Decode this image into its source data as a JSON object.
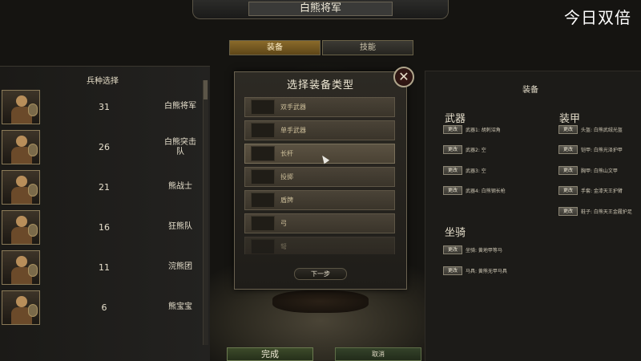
{
  "window": {
    "title": "白熊将军",
    "watermark": "今日双倍"
  },
  "tabs": [
    {
      "label": "装备",
      "active": true
    },
    {
      "label": "技能",
      "active": false
    }
  ],
  "left_panel": {
    "header": "兵种选择",
    "units": [
      {
        "count": "31",
        "name": "白熊将军"
      },
      {
        "count": "26",
        "name": "白熊突击队"
      },
      {
        "count": "21",
        "name": "熊战士"
      },
      {
        "count": "16",
        "name": "狂熊队"
      },
      {
        "count": "11",
        "name": "浣熊团"
      },
      {
        "count": "6",
        "name": "熊宝宝"
      }
    ]
  },
  "dialog": {
    "title": "选择装备类型",
    "close_icon": "close-icon",
    "options": [
      {
        "label": "双手武器"
      },
      {
        "label": "单手武器"
      },
      {
        "label": "长杆"
      },
      {
        "label": "投掷"
      },
      {
        "label": "盾牌"
      },
      {
        "label": "弓"
      },
      {
        "label": "弩"
      }
    ],
    "next_label": "下一步"
  },
  "right_panel": {
    "title": "装备",
    "weapons_title": "武器",
    "armor_title": "装甲",
    "mount_title": "坐骑",
    "change_label": "更改",
    "weapons": [
      "武器1: 胡刺沼角",
      "武器2: 空",
      "武器3: 空",
      "武器4: 白熊钢长枪"
    ],
    "armor": [
      "头盔: 白熊武绒光盔",
      "铠甲: 白熊光泽护甲",
      "胸甲: 白熊山文甲",
      "手套: 金漆天王护臂",
      "鞋子: 白熊天王金履护足"
    ],
    "mounts": [
      "坐骑: 黄地甲等马",
      "马具: 黄熊无甲马具"
    ]
  },
  "bottom": {
    "done_label": "完成",
    "cancel_label": "取消"
  },
  "colors": {
    "active_tab": "#8a6a2a",
    "accent_gold": "#cdbf9a",
    "panel_bg": "#1c1b18"
  }
}
